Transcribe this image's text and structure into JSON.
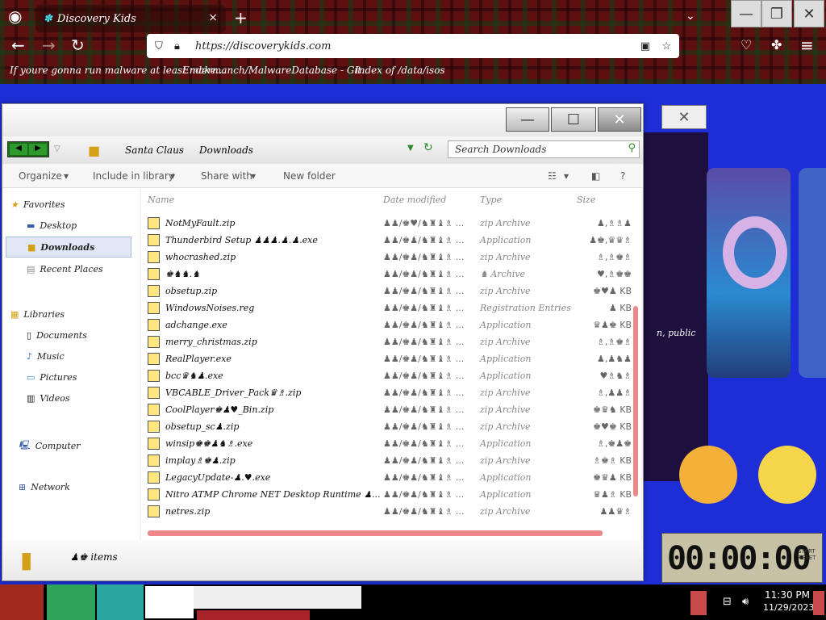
{
  "browser": {
    "tab_title": "Discovery Kids",
    "tab_close": "×",
    "new_tab": "+",
    "url": "https://discoverykids.com",
    "bookmarks": [
      "If youre gonna run malware at least make...",
      "Endermanch/MalwareDatabase - Git...",
      "Index of /data/isos"
    ]
  },
  "explorer": {
    "path": [
      "Santa Claus",
      "Downloads"
    ],
    "search_placeholder": "Search Downloads",
    "toolbar": {
      "organize": "Organize",
      "include": "Include in library",
      "share": "Share with",
      "new_folder": "New folder"
    },
    "columns": {
      "name": "Name",
      "date": "Date modified",
      "type": "Type",
      "size": "Size"
    },
    "nav": {
      "favorites": "Favorites",
      "desktop": "Desktop",
      "downloads": "Downloads",
      "recent": "Recent Places",
      "libraries": "Libraries",
      "documents": "Documents",
      "music": "Music",
      "pictures": "Pictures",
      "videos": "Videos",
      "computer": "Computer",
      "network": "Network"
    },
    "files": [
      {
        "name": "NotMyFault.zip",
        "date": "♟♟/♚♥/♞♜♝♗ ...",
        "type": "zip Archive",
        "size": "♟,♗♗♟"
      },
      {
        "name": "Thunderbird Setup ♟♟♟.♟.♟.exe",
        "date": "♟♟/♚♟/♞♜♝♗ ...",
        "type": "Application",
        "size": "♟♚,♛♛♗"
      },
      {
        "name": "whocrashed.zip",
        "date": "♟♟/♚♟/♞♜♝♗ ...",
        "type": "zip Archive",
        "size": "♗,♗♚♗"
      },
      {
        "name": "♚♞♞.♞",
        "date": "♟♟/♚♟/♞♜♝♗ ...",
        "type": "♞ Archive",
        "size": "♥,♗♚♚"
      },
      {
        "name": "obsetup.zip",
        "date": "♟♟/♚♟/♞♜♝♗ ...",
        "type": "zip Archive",
        "size": "♚♥♟ KB"
      },
      {
        "name": "WindowsNoises.reg",
        "date": "♟♟/♚♟/♞♜♝♗ ...",
        "type": "Registration Entries",
        "size": "♟ KB"
      },
      {
        "name": "adchange.exe",
        "date": "♟♟/♚♟/♞♜♝♗ ...",
        "type": "Application",
        "size": "♛♟♚ KB"
      },
      {
        "name": "merry_christmas.zip",
        "date": "♟♟/♚♟/♞♜♝♗ ...",
        "type": "zip Archive",
        "size": "♗,♗♚♗"
      },
      {
        "name": "RealPlayer.exe",
        "date": "♟♟/♚♟/♞♜♝♗ ...",
        "type": "Application",
        "size": "♟,♟♞♟"
      },
      {
        "name": "bcc♛♞♟.exe",
        "date": "♟♟/♚♟/♞♜♝♗ ...",
        "type": "Application",
        "size": "♥♗♞♗"
      },
      {
        "name": "VBCABLE_Driver_Pack♛♗.zip",
        "date": "♟♟/♚♟/♞♜♝♗ ...",
        "type": "zip Archive",
        "size": "♗,♟♟♗"
      },
      {
        "name": "CoolPlayer♚♟♥_Bin.zip",
        "date": "♟♟/♚♟/♞♜♝♗ ...",
        "type": "zip Archive",
        "size": "♚♛♞ KB"
      },
      {
        "name": "obsetup_sc♟.zip",
        "date": "♟♟/♚♟/♞♜♝♗ ...",
        "type": "zip Archive",
        "size": "♚♥♚ KB"
      },
      {
        "name": "winsip♚♚♟♞♗.exe",
        "date": "♟♟/♚♟/♞♜♝♗ ...",
        "type": "Application",
        "size": "♗,♚♟♚"
      },
      {
        "name": "implay♗♚♟.zip",
        "date": "♟♟/♚♟/♞♜♝♗ ...",
        "type": "zip Archive",
        "size": "♗♚♗ KB"
      },
      {
        "name": "LegacyUpdate-♟.♥.exe",
        "date": "♟♟/♚♟/♞♜♝♗ ...",
        "type": "Application",
        "size": "♚♛♟ KB"
      },
      {
        "name": "Nitro ATMP Chrome NET Desktop Runtime ♟...",
        "date": "♟♟/♚♟/♞♜♝♗ ...",
        "type": "Application",
        "size": "♛♟♗ KB"
      },
      {
        "name": "netres.zip",
        "date": "♟♟/♚♟/♞♜♝♗ ...",
        "type": "zip Archive",
        "size": "♟♟♛♗"
      }
    ],
    "status": "♟♚ items"
  },
  "page": {
    "public_text": "n, public"
  },
  "clock": {
    "display": "00:00:00",
    "small": "START RESET"
  },
  "taskbar": {
    "time": "11:30 PM",
    "date": "11/29/2023"
  }
}
